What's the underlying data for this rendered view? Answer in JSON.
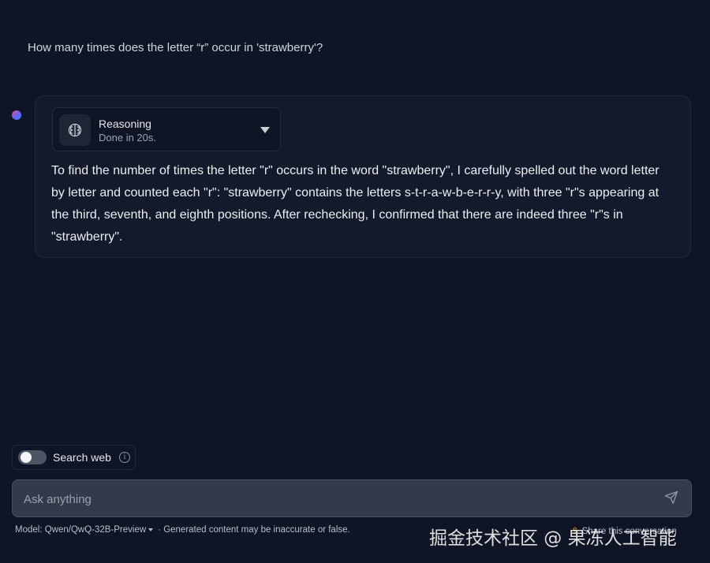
{
  "conversation": {
    "user_message": "How many times does the letter “r” occur in 'strawberry'?",
    "reasoning": {
      "title": "Reasoning",
      "status": "Done in 20s.",
      "icon": "brain-icon"
    },
    "assistant_message": "To find the number of times the letter \"r\" occurs in the word \"strawberry\", I carefully spelled out the word letter by letter and counted each \"r\": \"strawberry\" contains the letters s-t-r-a-w-b-e-r-r-y, with three \"r\"s appearing at the third, seventh, and eighth positions. After rechecking, I confirmed that there are indeed three \"r\"s in \"strawberry\"."
  },
  "search_web": {
    "label": "Search web",
    "enabled": false,
    "info_icon": "info-icon"
  },
  "composer": {
    "placeholder": "Ask anything",
    "value": "",
    "send_icon": "send-icon"
  },
  "footer": {
    "model_label": "Model: Qwen/QwQ-32B-Preview",
    "disclaimer": "· Generated content may be inaccurate or false.",
    "share_label": "Share this conversation"
  },
  "watermark": {
    "text": "掘金技术社区 @ 果冻人工智能"
  },
  "colors": {
    "background": "#0f1524",
    "card": "#121a2b",
    "input": "#333b4a",
    "accent_gradient": [
      "#ec4899",
      "#6366f1",
      "#3b82f6"
    ]
  }
}
